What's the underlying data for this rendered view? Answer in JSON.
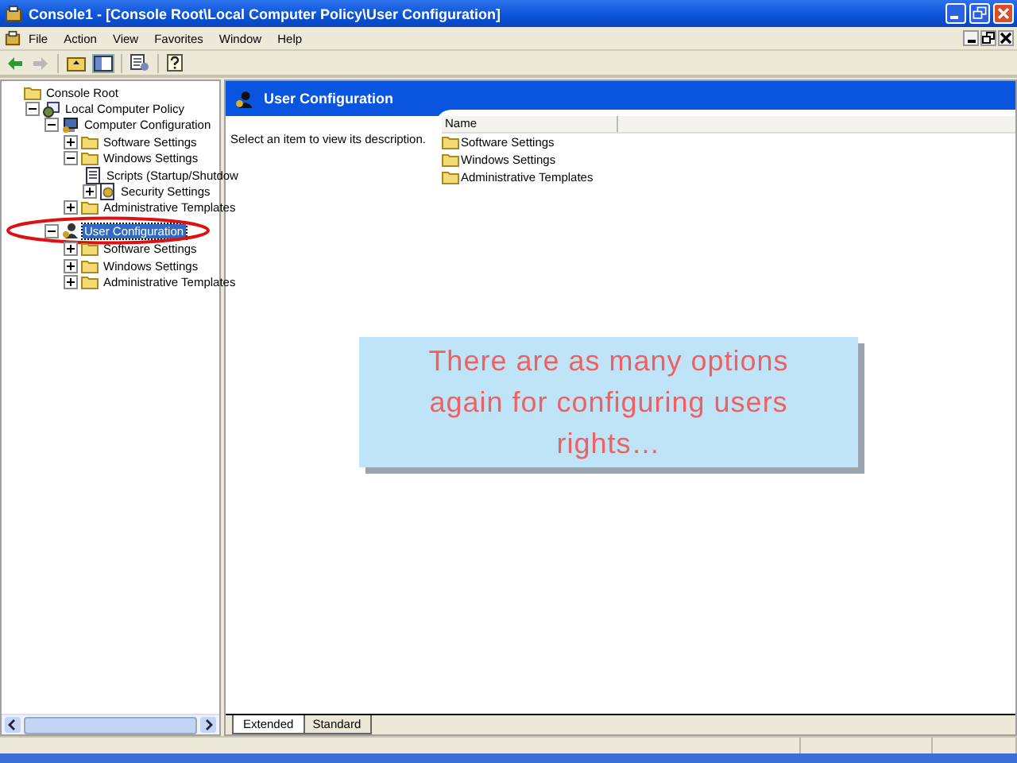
{
  "window": {
    "title": "Console1 - [Console Root\\Local Computer Policy\\User Configuration]"
  },
  "menu": [
    "File",
    "Action",
    "View",
    "Favorites",
    "Window",
    "Help"
  ],
  "tree": [
    {
      "label": "Console Root",
      "kind": "folder",
      "selected": false,
      "circled": false,
      "children": [
        {
          "label": "Local Computer Policy",
          "kind": "policy",
          "expanded": true,
          "selected": false,
          "circled": false,
          "children": [
            {
              "label": "Computer Configuration",
              "kind": "computer",
              "expanded": true,
              "selected": false,
              "circled": false,
              "children": [
                {
                  "label": "Software Settings",
                  "kind": "folder",
                  "expanded": false,
                  "selected": false,
                  "circled": false
                },
                {
                  "label": "Windows Settings",
                  "kind": "folder",
                  "expanded": true,
                  "selected": false,
                  "circled": false,
                  "children": [
                    {
                      "label": "Scripts (Startup/Shutdow",
                      "kind": "script",
                      "selected": false,
                      "circled": false
                    },
                    {
                      "label": "Security Settings",
                      "kind": "security",
                      "expanded": false,
                      "selected": false,
                      "circled": false
                    }
                  ]
                },
                {
                  "label": "Administrative Templates",
                  "kind": "folder",
                  "expanded": false,
                  "selected": false,
                  "circled": false
                }
              ]
            },
            {
              "label": "User Configuration",
              "kind": "user",
              "expanded": true,
              "selected": true,
              "circled": true,
              "children": [
                {
                  "label": "Software Settings",
                  "kind": "folder",
                  "expanded": false,
                  "selected": false,
                  "circled": false
                },
                {
                  "label": "Windows Settings",
                  "kind": "folder",
                  "expanded": false,
                  "selected": false,
                  "circled": false
                },
                {
                  "label": "Administrative Templates",
                  "kind": "folder",
                  "expanded": false,
                  "selected": false,
                  "circled": false
                }
              ]
            }
          ]
        }
      ]
    }
  ],
  "details": {
    "title": "User Configuration",
    "description": "Select an item to view its description.",
    "columns": [
      "Name"
    ],
    "items": [
      "Software Settings",
      "Windows Settings",
      "Administrative Templates"
    ]
  },
  "tabs": [
    {
      "label": "Extended",
      "selected": true
    },
    {
      "label": "Standard",
      "selected": false
    }
  ],
  "callout": {
    "text": "There are as many options again for configuring users rights…"
  }
}
